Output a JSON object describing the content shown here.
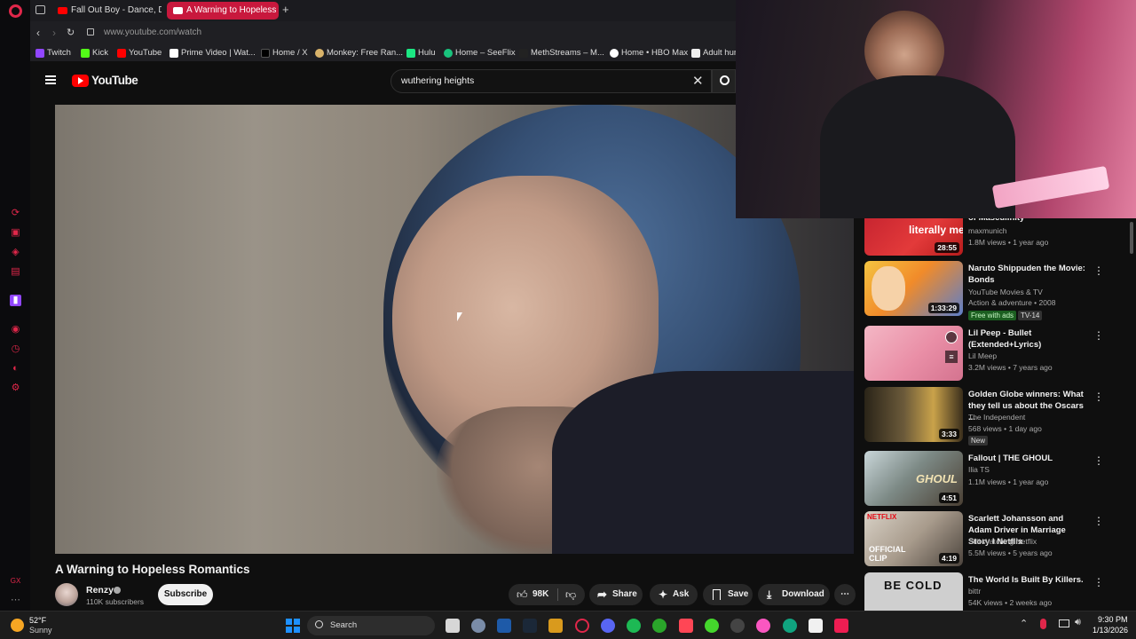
{
  "browser": {
    "tabs": [
      {
        "label": "Fall Out Boy - Dance, Danc"
      },
      {
        "label": "A Warning to Hopeless Ro"
      }
    ],
    "new_tab": "+",
    "url": "www.youtube.com/watch",
    "bookmarks": [
      "Twitch",
      "Kick",
      "YouTube",
      "Prime Video | Wat...",
      "Home / X",
      "Monkey: Free Ran...",
      "Hulu",
      "Home – SeeFlix",
      "MethStreams – M...",
      "Home • HBO Max",
      "Adult hun"
    ]
  },
  "youtube": {
    "logo": "YouTube",
    "search_value": "wuthering heights",
    "video": {
      "title": "A Warning to Hopeless Romantics",
      "channel": "Renzy",
      "subscribers": "110K subscribers",
      "subscribe_label": "Subscribe",
      "likes": "98K",
      "share": "Share",
      "ask": "Ask",
      "save": "Save",
      "download": "Download"
    },
    "recommendations": [
      {
        "title": "of Masculinity",
        "channel": "maxmunich",
        "meta": "1.8M views • 1 year ago",
        "duration": "28:55",
        "thumb_text": "literally me."
      },
      {
        "title": "Naruto Shippuden the Movie: Bonds",
        "channel": "YouTube Movies & TV",
        "meta": "Action & adventure • 2008",
        "duration": "1:33:29",
        "badge1": "Free with ads",
        "badge2": "TV-14"
      },
      {
        "title": "Lil Peep - Bullet (Extended+Lyrics)",
        "channel": "Lil Meep",
        "meta": "3.2M views • 7 years ago"
      },
      {
        "title": "Golden Globe winners: What they tell us about the Oscars ...",
        "channel": "The Independent",
        "meta": "568 views • 1 day ago",
        "duration": "3:33",
        "badge1": "New"
      },
      {
        "title": "Fallout | THE GHOUL",
        "channel": "Ilia TS",
        "meta": "1.1M views • 1 year ago",
        "duration": "4:51",
        "thumb_text": "GHOUL"
      },
      {
        "title": "Scarlett Johansson and Adam Driver in Marriage Story l Netflix",
        "channel": "Still Watching Netflix",
        "meta": "5.5M views • 5 years ago",
        "duration": "4:19",
        "thumb_text": "OFFICIAL CLIP",
        "thumb_brand": "NETFLIX"
      },
      {
        "title": "The World Is Built By Killers.",
        "channel": "bittr",
        "meta": "54K views • 2 weeks ago",
        "thumb_text": "BE COLD"
      }
    ]
  },
  "taskbar": {
    "weather_temp": "52°F",
    "weather_desc": "Sunny",
    "search": "Search",
    "time": "9:30 PM",
    "date": "1/13/2026"
  },
  "colors": {
    "opera_red": "#e0274a",
    "yt_red": "#ff0000",
    "tab_active": "#c8183d"
  }
}
